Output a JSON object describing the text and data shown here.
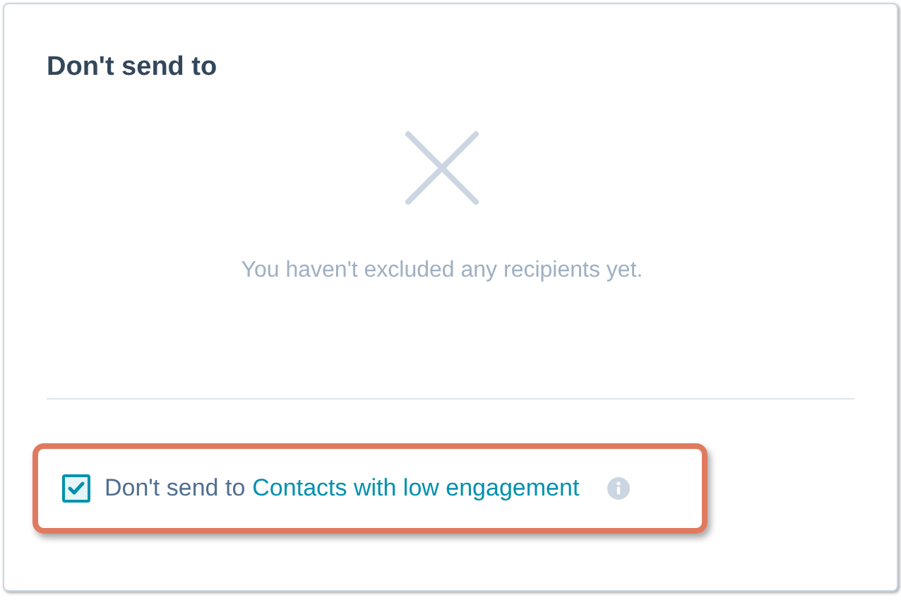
{
  "card": {
    "title": "Don't send to",
    "empty_message": "You haven't excluded any recipients yet."
  },
  "option": {
    "checked": true,
    "label": "Don't send to",
    "link": "Contacts with low engagement"
  }
}
